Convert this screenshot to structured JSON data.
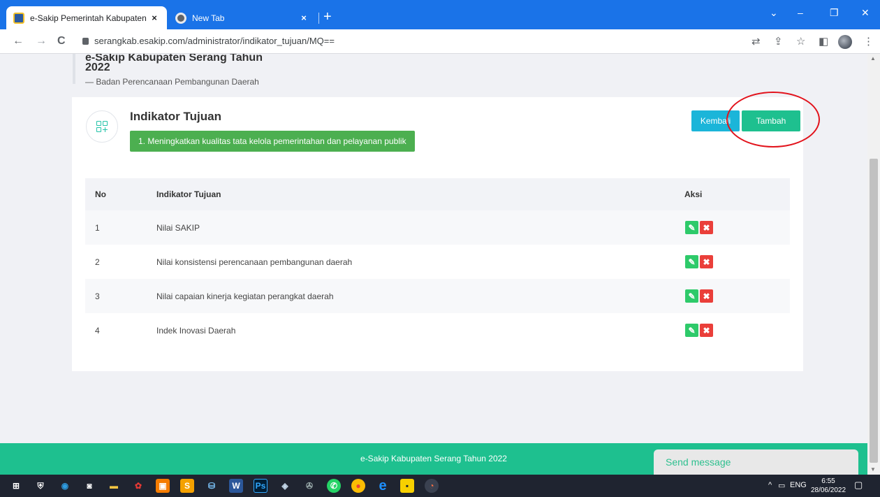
{
  "browser": {
    "tabs": [
      {
        "title": "e-Sakip Pemerintah Kabupaten S",
        "close": "×"
      },
      {
        "title": "New Tab",
        "close": "×"
      }
    ],
    "new_tab": "+",
    "window_controls": {
      "chevron": "⌄",
      "minimize": "–",
      "restore": "❐",
      "close": "✕"
    },
    "nav": {
      "back": "←",
      "forward": "→",
      "reload": "C"
    },
    "url": "serangkab.esakip.com/administrator/indikator_tujuan/MQ==",
    "toolbar_icons": [
      "translate-icon",
      "share-icon",
      "star-icon",
      "sidebar-icon",
      "profile-avatar",
      "menu-icon"
    ]
  },
  "header": {
    "title": "e-Sakip Kabupaten Serang Tahun 2022",
    "subtitle": "— Badan Perencanaan Pembangunan Daerah"
  },
  "card": {
    "title": "Indikator Tujuan",
    "badge": "1. Meningkatkan kualitas tata kelola pemerintahan dan pelayanan publik",
    "buttons": {
      "back": "Kembali",
      "add": "Tambah"
    }
  },
  "table": {
    "headers": {
      "no": "No",
      "indikator": "Indikator Tujuan",
      "aksi": "Aksi"
    },
    "rows": [
      {
        "no": "1",
        "indikator": "Nilai SAKIP"
      },
      {
        "no": "2",
        "indikator": "Nilai konsistensi perencanaan pembangunan daerah"
      },
      {
        "no": "3",
        "indikator": "Nilai capaian kinerja kegiatan perangkat daerah"
      },
      {
        "no": "4",
        "indikator": "Indek Inovasi Daerah"
      }
    ],
    "actions": {
      "edit": "✎",
      "delete": "✖"
    }
  },
  "footer": {
    "text": "e-Sakip Kabupaten Serang Tahun 2022"
  },
  "chat": {
    "label": "Send message"
  },
  "taskbar": {
    "lang": "ENG",
    "time": "6:55",
    "date": "28/06/2022",
    "tray_chevron": "^"
  },
  "colors": {
    "accent": "#1ec08f",
    "info": "#1bb5d9",
    "badge": "#4caf50",
    "danger": "#ea3f3a",
    "browser": "#1a73e8"
  }
}
